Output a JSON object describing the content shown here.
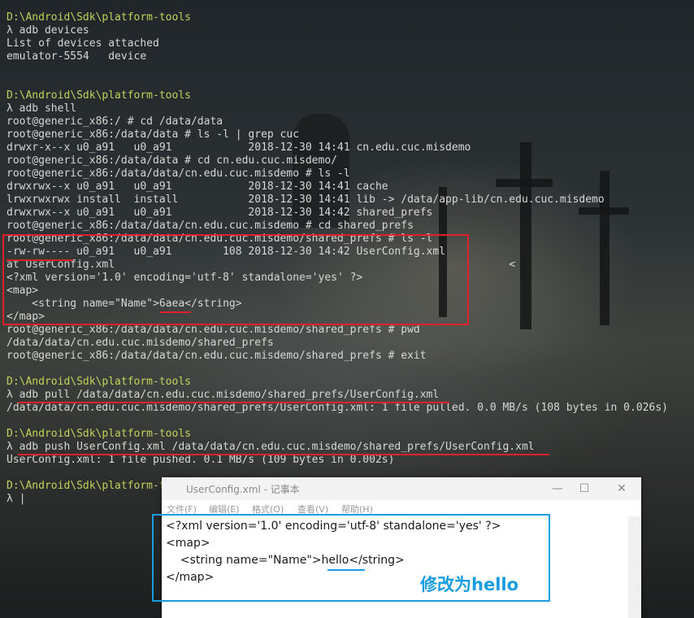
{
  "terminal": {
    "lines": [
      {
        "text": "D:\\Android\\Sdk\\platform-tools",
        "kind": "path"
      },
      {
        "text": "λ adb devices",
        "kind": "cmd"
      },
      {
        "text": "List of devices attached",
        "kind": "out"
      },
      {
        "text": "emulator-5554   device",
        "kind": "out"
      },
      {
        "text": "",
        "kind": "out"
      },
      {
        "text": "",
        "kind": "out"
      },
      {
        "text": "D:\\Android\\Sdk\\platform-tools",
        "kind": "path"
      },
      {
        "text": "λ adb shell",
        "kind": "cmd"
      },
      {
        "text": "root@generic_x86:/ # cd /data/data",
        "kind": "out"
      },
      {
        "text": "root@generic_x86:/data/data # ls -l | grep cuc",
        "kind": "out"
      },
      {
        "text": "drwxr-x--x u0_a91   u0_a91            2018-12-30 14:41 cn.edu.cuc.misdemo",
        "kind": "out"
      },
      {
        "text": "root@generic_x86:/data/data # cd cn.edu.cuc.misdemo/",
        "kind": "out"
      },
      {
        "text": "root@generic_x86:/data/data/cn.edu.cuc.misdemo # ls -l",
        "kind": "out"
      },
      {
        "text": "drwxrwx--x u0_a91   u0_a91            2018-12-30 14:41 cache",
        "kind": "out"
      },
      {
        "text": "lrwxrwxrwx install  install           2018-12-30 14:41 lib -> /data/app-lib/cn.edu.cuc.misdemo",
        "kind": "out"
      },
      {
        "text": "drwxrwx--x u0_a91   u0_a91            2018-12-30 14:42 shared_prefs",
        "kind": "out"
      },
      {
        "text": "root@generic_x86:/data/data/cn.edu.cuc.misdemo # cd shared_prefs",
        "kind": "out"
      },
      {
        "text": "root@generic_x86:/data/data/cn.edu.cuc.misdemo/shared_prefs # ls -l",
        "kind": "out"
      },
      {
        "text": "-rw-rw---- u0_a91   u0_a91        108 2018-12-30 14:42 UserConfig.xml",
        "kind": "out"
      },
      {
        "text": "at UserConfig.xml                                                              <",
        "kind": "out"
      },
      {
        "text": "<?xml version='1.0' encoding='utf-8' standalone='yes' ?>",
        "kind": "out"
      },
      {
        "text": "<map>",
        "kind": "out"
      },
      {
        "text": "    <string name=\"Name\">6aea</string>",
        "kind": "out"
      },
      {
        "text": "</map>",
        "kind": "out"
      },
      {
        "text": "root@generic_x86:/data/data/cn.edu.cuc.misdemo/shared_prefs # pwd",
        "kind": "out"
      },
      {
        "text": "/data/data/cn.edu.cuc.misdemo/shared_prefs",
        "kind": "out"
      },
      {
        "text": "root@generic_x86:/data/data/cn.edu.cuc.misdemo/shared_prefs # exit",
        "kind": "out"
      },
      {
        "text": "",
        "kind": "out"
      },
      {
        "text": "D:\\Android\\Sdk\\platform-tools",
        "kind": "path"
      },
      {
        "text": "λ adb pull /data/data/cn.edu.cuc.misdemo/shared_prefs/UserConfig.xml",
        "kind": "cmd"
      },
      {
        "text": "/data/data/cn.edu.cuc.misdemo/shared_prefs/UserConfig.xml: 1 file pulled. 0.0 MB/s (108 bytes in 0.026s)",
        "kind": "out"
      },
      {
        "text": "",
        "kind": "out"
      },
      {
        "text": "D:\\Android\\Sdk\\platform-tools",
        "kind": "path"
      },
      {
        "text": "λ adb push UserConfig.xml /data/data/cn.edu.cuc.misdemo/shared_prefs/UserConfig.xml",
        "kind": "cmd"
      },
      {
        "text": "UserConfig.xml: 1 file pushed. 0.1 MB/s (109 bytes in 0.002s)",
        "kind": "out"
      },
      {
        "text": "",
        "kind": "out"
      },
      {
        "text": "D:\\Android\\Sdk\\platform-tools",
        "kind": "path"
      },
      {
        "text": "λ |",
        "kind": "cmd"
      }
    ]
  },
  "notepad": {
    "title": "UserConfig.xml - 记事本",
    "menu": [
      "文件(F)",
      "编辑(E)",
      "格式(O)",
      "查看(V)",
      "帮助(H)"
    ],
    "controls": {
      "minimize": "—",
      "maximize": "☐",
      "close": "✕"
    },
    "content": [
      "<?xml version='1.0' encoding='utf-8' standalone='yes' ?>",
      "<map>",
      "    <string name=\"Name\">hello</string>",
      "</map>"
    ]
  },
  "annotation": {
    "label": "修改为hello",
    "colors": {
      "red": "#e0202a",
      "blue": "#1a9de0",
      "path": "#c3d25b"
    }
  }
}
